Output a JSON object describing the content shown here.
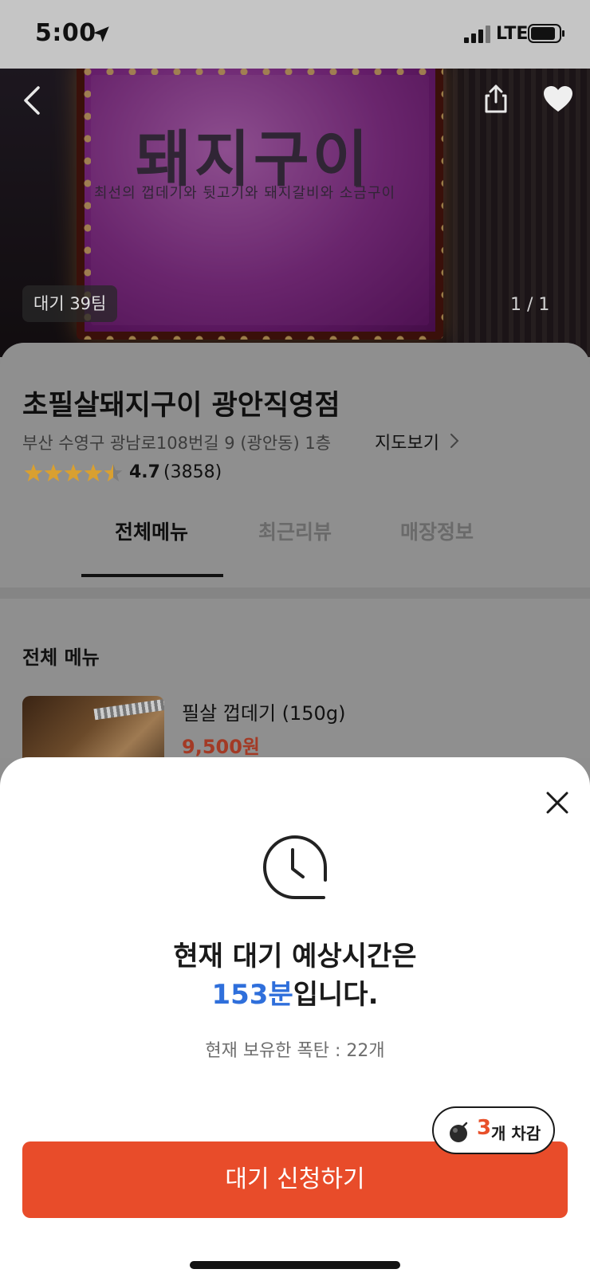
{
  "status_bar": {
    "time": "5:00",
    "network": "LTE"
  },
  "hero": {
    "sign_title": "돼지구이",
    "sign_subtitle": "최선의 껍데기와 뒷고기와 돼지갈비와 소금구이",
    "wait_badge": "대기 39팀",
    "page_indicator": "1 / 1"
  },
  "store": {
    "name": "초필살돼지구이 광안직영점",
    "address": "부산 수영구 광남로108번길 9 (광안동) 1층",
    "map_link": "지도보기",
    "rating": "4.7",
    "review_count": "(3858)",
    "rating_stars_value": 4.5
  },
  "tabs": [
    {
      "label": "전체메뉴",
      "active": true
    },
    {
      "label": "최근리뷰",
      "active": false
    },
    {
      "label": "매장정보",
      "active": false
    }
  ],
  "menu": {
    "section_title": "전체 메뉴",
    "items": [
      {
        "name": "필살 껍데기 (150g)",
        "price": "9,500원"
      }
    ]
  },
  "sheet": {
    "wait_prefix": "현재 대기 예상시간은",
    "wait_minutes": "153분",
    "wait_suffix": "입니다.",
    "bomb_count": "현재 보유한 폭탄 : 22개",
    "deduct_number": "3",
    "deduct_text": "개 차감",
    "apply_button": "대기 신청하기"
  },
  "colors": {
    "accent": "#e84c2a",
    "wait_minutes": "#2f6fdb",
    "price": "#a33a25",
    "star": "#d9a030"
  }
}
